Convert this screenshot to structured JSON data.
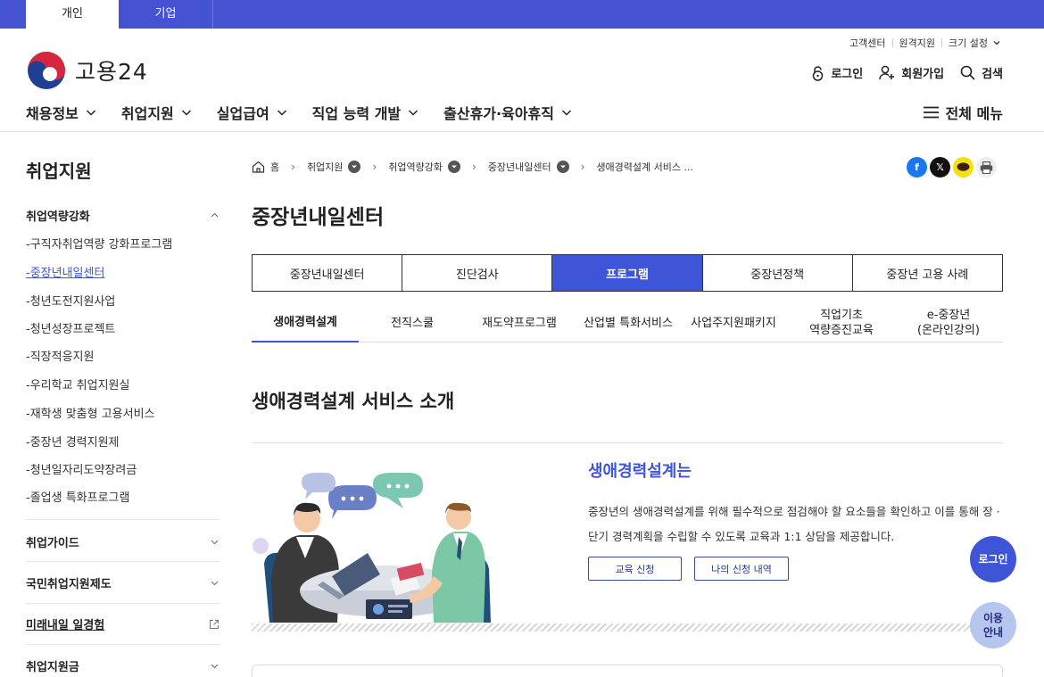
{
  "topbar": {
    "tabs": [
      "개인",
      "기업"
    ]
  },
  "header": {
    "util": [
      "고객센터",
      "원격지원",
      "크기 설정"
    ],
    "logo_text": "고용24",
    "actions": {
      "login": "로그인",
      "signup": "회원가입",
      "search": "검색"
    },
    "gnb": [
      "채용정보",
      "취업지원",
      "실업급여",
      "직업 능력 개발",
      "출산휴가·육아휴직"
    ],
    "all_menu": "전체 메뉴"
  },
  "sidebar": {
    "title": "취업지원",
    "section_open": "취업역량강화",
    "items": [
      "-구직자취업역량 강화프로그램",
      "-중장년내일센터",
      "-청년도전지원사업",
      "-청년성장프로젝트",
      "-직장적응지원",
      "-우리학교 취업지원실",
      "-재학생 맞춤형 고용서비스",
      "-중장년 경력지원제",
      "-청년일자리도약장려금",
      "-졸업생 특화프로그램"
    ],
    "sections": [
      "취업가이드",
      "국민취업지원제도",
      "미래내일 일경험",
      "취업지원금"
    ]
  },
  "breadcrumb": [
    "홈",
    "취업지원",
    "취업역량강화",
    "중장년내일센터",
    "생애경력설계 서비스 ..."
  ],
  "page_title": "중장년내일센터",
  "tabs": [
    "중장년내일센터",
    "진단검사",
    "프로그램",
    "중장년정책",
    "중장년 고용 사례"
  ],
  "active_tab": "프로그램",
  "subtabs": [
    "생애경력설계",
    "전직스쿨",
    "재도약프로그램",
    "산업별 특화서비스",
    "사업주지원패키지",
    "직업기초\n역량증진교육",
    "e-중장년\n(온라인강의)"
  ],
  "section_title": "생애경력설계 서비스 소개",
  "intro": {
    "heading": "생애경력설계는",
    "body": "중장년의 생애경력설계를 위해 필수적으로 점검해야 할 요소들을 확인하고 이를 통해 장 · 단기 경력계획을 수립할 수 있도록 교육과 1:1 상담을 제공합니다.",
    "btn_apply": "교육 신청",
    "btn_history": "나의 신청 내역"
  },
  "floating": {
    "login": "로그인",
    "guide": "이용\n안내"
  },
  "colors": {
    "primary": "#3f55d8",
    "topbar": "#4553d3"
  }
}
